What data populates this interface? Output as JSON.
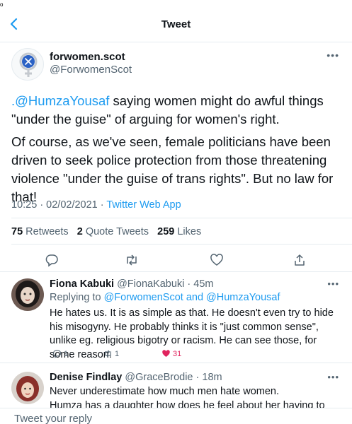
{
  "status_bar": {
    "indicator": "o"
  },
  "header": {
    "title": "Tweet"
  },
  "tweet": {
    "author_name": "forwomen.scot",
    "author_handle": "@ForwomenScot",
    "mention": ".@HumzaYousaf",
    "text_p1_rest": " saying women might do awful things \"under the guise\" of arguing for women's right.",
    "text_p2": "Of course, as we've seen, female politicians have been driven to seek police protection from those threatening violence \"under the guise of trans rights\". But no law for that!",
    "time": "10:25 · 02/02/2021 · ",
    "source": "Twitter Web App",
    "retweets_count": "75",
    "retweets_label": " Retweets",
    "quote_count": "2",
    "quote_label": " Quote Tweets",
    "likes_count": "259",
    "likes_label": " Likes"
  },
  "replies": [
    {
      "name": "Fiona Kabuki",
      "handle": " @FionaKabuki · 45m",
      "replying_prefix": "Replying to ",
      "replying_to": "@ForwomenScot and @HumzaYousaf",
      "text": "He hates us. It is as simple as that. He doesn't even try to hide his misogyny. He probably thinks it is \"just common sense\", unlike eg. religious bigotry or racism. He can see those, for some reason.",
      "reply_count": "1",
      "retweet_count": "1",
      "like_count": "31"
    },
    {
      "name": "Denise Findlay",
      "handle": " @GraceBrodie · 18m",
      "text": "Never underestimate how much men hate women.\nHumza has a daughter how does he feel about her having to change in"
    }
  ],
  "compose": {
    "placeholder": "Tweet your reply"
  },
  "colors": {
    "accent": "#1d9bf0",
    "like": "#e0245e",
    "muted": "#536471"
  }
}
